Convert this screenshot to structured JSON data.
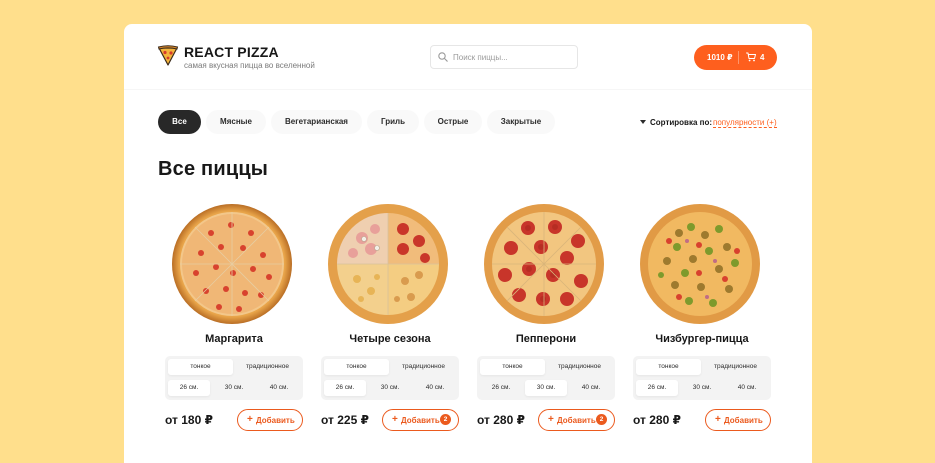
{
  "header": {
    "brand_title": "REACT PIZZA",
    "brand_subtitle": "самая вкусная пицца во вселенной",
    "search_placeholder": "Поиск пиццы...",
    "cart_price": "1010 ₽",
    "cart_count": "4"
  },
  "categories": [
    "Все",
    "Мясные",
    "Вегетарианская",
    "Гриль",
    "Острые",
    "Закрытые"
  ],
  "active_category": "Все",
  "sort": {
    "label": "Сортировка по:",
    "value": "популярности (+)"
  },
  "page_title": "Все пиццы",
  "pizzas": [
    {
      "name": "Маргарита",
      "dough": [
        "тонкое",
        "традиционное"
      ],
      "sizes": [
        "26 см.",
        "30 см.",
        "40 см."
      ],
      "price": "от 180 ₽",
      "add_label": "Добавить",
      "count": ""
    },
    {
      "name": "Четыре сезона",
      "dough": [
        "тонкое",
        "традиционное"
      ],
      "sizes": [
        "26 см.",
        "30 см.",
        "40 см."
      ],
      "price": "от 225 ₽",
      "add_label": "Добавить",
      "count": "2"
    },
    {
      "name": "Пепперони",
      "dough": [
        "тонкое",
        "традиционное"
      ],
      "sizes": [
        "26 см.",
        "30 см.",
        "40 см."
      ],
      "price": "от 280 ₽",
      "add_label": "Добавить",
      "count": "2"
    },
    {
      "name": "Чизбургер-пицца",
      "dough": [
        "тонкое",
        "традиционное"
      ],
      "sizes": [
        "26 см.",
        "30 см.",
        "40 см."
      ],
      "price": "от 280 ₽",
      "add_label": "Добавить",
      "count": ""
    }
  ],
  "selected": [
    {
      "dough": 0,
      "size": 0
    },
    {
      "dough": 0,
      "size": 0
    },
    {
      "dough": 0,
      "size": 1
    },
    {
      "dough": 0,
      "size": 0
    }
  ],
  "colors": {
    "accent": "#FE5F1E",
    "background": "#FFDF8C",
    "active_category": "#282828"
  },
  "icons": {
    "logo": "pizza-slice-icon",
    "search": "search-icon",
    "cart": "cart-icon",
    "sort": "triangle-down-icon",
    "add": "plus-icon"
  }
}
